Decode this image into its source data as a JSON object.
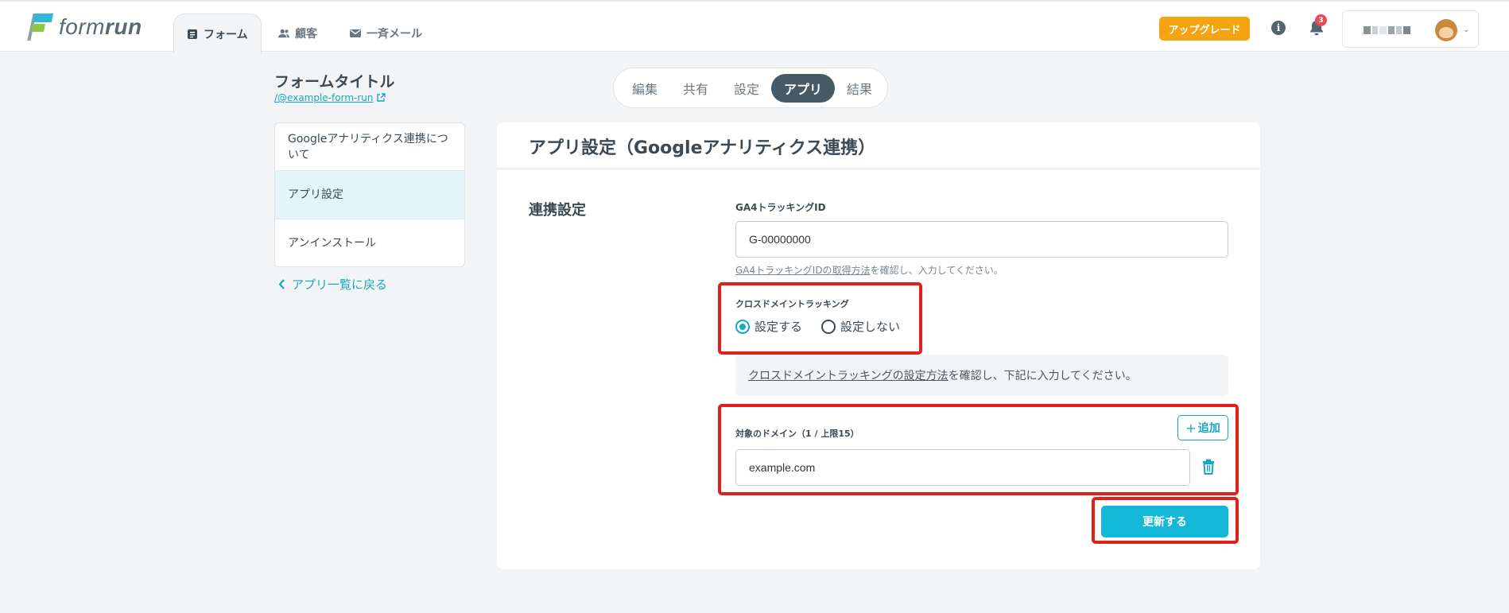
{
  "header": {
    "logo_text_light": "form",
    "logo_text_bold": "run",
    "nav": [
      {
        "label": "フォーム",
        "icon": "form-icon",
        "active": true
      },
      {
        "label": "顧客",
        "icon": "users-icon",
        "active": false
      },
      {
        "label": "一斉メール",
        "icon": "mail-icon",
        "active": false
      }
    ],
    "upgrade_label": "アップグレード",
    "notification_count": "3",
    "accent_color": "#f6a312"
  },
  "sidebar": {
    "form_title": "フォームタイトル",
    "form_link": "/@example-form-run",
    "items": [
      {
        "label": "Googleアナリティクス連携について"
      },
      {
        "label": "アプリ設定"
      },
      {
        "label": "アンインストール"
      }
    ],
    "back_label": "アプリ一覧に戻る"
  },
  "tabs": [
    {
      "label": "編集"
    },
    {
      "label": "共有"
    },
    {
      "label": "設定"
    },
    {
      "label": "アプリ",
      "active": true
    },
    {
      "label": "結果"
    }
  ],
  "main": {
    "title": "アプリ設定（Googleアナリティクス連携）",
    "section_label": "連携設定",
    "ga4": {
      "label": "GA4トラッキングID",
      "value": "G-00000000",
      "hint_link": "GA4トラッキングIDの取得方法",
      "hint_rest": "を確認し、入力してください。"
    },
    "cross_domain": {
      "label": "クロスドメイントラッキング",
      "options": [
        {
          "label": "設定する",
          "selected": true
        },
        {
          "label": "設定しない",
          "selected": false
        }
      ],
      "note_link": "クロスドメイントラッキングの設定方法",
      "note_rest": "を確認し、下記に入力してください。"
    },
    "domains": {
      "label": "対象のドメイン（1 / 上限15）",
      "add_label": "追加",
      "values": [
        "example.com"
      ]
    },
    "submit_label": "更新する"
  },
  "colors": {
    "primary": "#13b9d6",
    "highlight": "#e0201a",
    "dark": "#455a64"
  }
}
